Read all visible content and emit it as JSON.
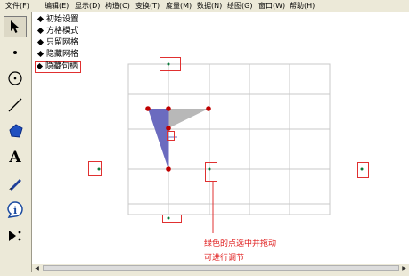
{
  "menu": [
    {
      "label": "文件(F)"
    },
    {
      "label": "编辑(E)"
    },
    {
      "label": "显示(D)"
    },
    {
      "label": "构造(C)"
    },
    {
      "label": "变换(T)"
    },
    {
      "label": "度量(M)"
    },
    {
      "label": "数据(N)"
    },
    {
      "label": "绘图(G)"
    },
    {
      "label": "窗口(W)"
    },
    {
      "label": "帮助(H)"
    }
  ],
  "toolbar": {
    "tools": [
      {
        "name": "arrow-tool",
        "icon": "select-arrow-icon",
        "selected": true
      },
      {
        "name": "point-tool",
        "icon": "point-icon"
      },
      {
        "name": "compass-tool",
        "icon": "circle-icon"
      },
      {
        "name": "straightedge-tool",
        "icon": "line-segment-icon"
      },
      {
        "name": "polygon-tool",
        "icon": "polygon-icon"
      },
      {
        "name": "text-tool",
        "icon": "text-A-icon",
        "glyph": "A"
      },
      {
        "name": "marker-tool",
        "icon": "marker-pen-icon"
      },
      {
        "name": "information-tool",
        "icon": "info-icon",
        "glyph": "i"
      },
      {
        "name": "custom-tool",
        "icon": "custom-tool-icon"
      }
    ]
  },
  "buttons": [
    {
      "label": "初始设置"
    },
    {
      "label": "方格模式"
    },
    {
      "label": "只留网格"
    },
    {
      "label": "隐藏网格"
    },
    {
      "label": "隐藏句柄"
    }
  ],
  "annotation": {
    "line1": "绿色的点选中并拖动",
    "line2": "可进行调节"
  },
  "colors": {
    "ui_gray": "#ece9d8",
    "grid": "#c8c8c8",
    "triangle_blue": "#6b6bbf",
    "triangle_gray": "#b8b8b8",
    "point_red": "#c00000",
    "annotation_red": "#e02020",
    "handle_green": "#0a7a3a"
  }
}
